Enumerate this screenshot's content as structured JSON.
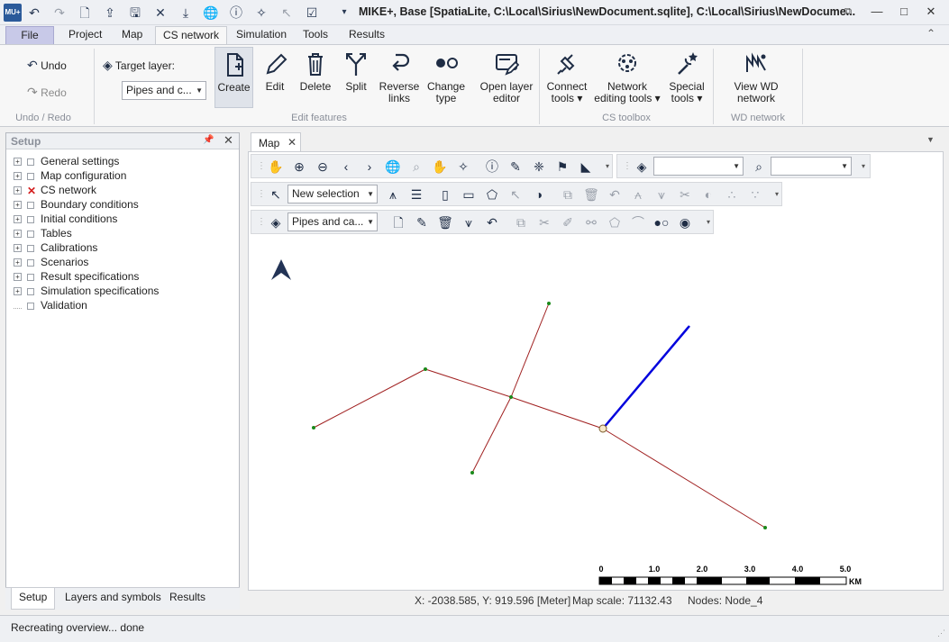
{
  "window": {
    "title": "MIKE+, Base [SpatiaLite, C:\\Local\\Sirius\\NewDocument.sqlite], C:\\Local\\Sirius\\NewDocume...",
    "minimize_icon": "restore-icon",
    "maximize_icon": "maximize-icon",
    "close_icon": "close-icon"
  },
  "quick_access": [
    "app-logo-icon",
    "undo-icon",
    "redo-icon",
    "new-document-icon",
    "open-icon",
    "save-icon",
    "close-document-icon",
    "import-icon",
    "globe-icon",
    "info-icon",
    "select-tool-icon",
    "deselect-tool-icon",
    "check-icon",
    "dropdown-icon"
  ],
  "tabs": [
    {
      "label": "File"
    },
    {
      "label": "Project"
    },
    {
      "label": "Map"
    },
    {
      "label": "CS network"
    },
    {
      "label": "Simulation"
    },
    {
      "label": "Tools"
    },
    {
      "label": "Results"
    }
  ],
  "active_tab": "CS network",
  "ribbon": {
    "undo_label": "Undo",
    "redo_label": "Redo",
    "target_layer_label": "Target layer:",
    "target_layer_value": "Pipes and c...",
    "create_label": "Create",
    "edit_label": "Edit",
    "delete_label": "Delete",
    "split_label": "Split",
    "reverse_label_1": "Reverse",
    "reverse_label_2": "links",
    "change_label_1": "Change",
    "change_label_2": "type",
    "open_layer_label_1": "Open layer",
    "open_layer_label_2": "editor",
    "connect_label_1": "Connect",
    "connect_label_2": "tools ▾",
    "network_label_1": "Network",
    "network_label_2": "editing tools ▾",
    "special_label_1": "Special",
    "special_label_2": "tools ▾",
    "wd_label_1": "View WD",
    "wd_label_2": "network",
    "groups": {
      "undo_redo": "Undo / Redo",
      "edit_features": "Edit features",
      "cs_toolbox": "CS toolbox",
      "wd_network": "WD network"
    }
  },
  "setup_panel": {
    "title": "Setup",
    "items": [
      {
        "label": "General settings"
      },
      {
        "label": "Map configuration"
      },
      {
        "label": "CS network"
      },
      {
        "label": "Boundary conditions"
      },
      {
        "label": "Initial conditions"
      },
      {
        "label": "Tables"
      },
      {
        "label": "Calibrations"
      },
      {
        "label": "Scenarios"
      },
      {
        "label": "Result specifications"
      },
      {
        "label": "Simulation specifications"
      },
      {
        "label": "Validation"
      }
    ],
    "bottom_tabs": [
      "Setup",
      "Layers and symbols",
      "Results"
    ]
  },
  "map": {
    "tab_label": "Map",
    "selection_combo": "New selection",
    "layer_combo": "Pipes and ca...",
    "search_combo": "",
    "layers_combo": "",
    "scale_ticks": [
      "0",
      "1.0",
      "2.0",
      "3.0",
      "4.0",
      "5.0"
    ],
    "scale_unit": "KM",
    "coords": "X: -2038.585, Y: 919.596 [Meter]",
    "map_scale": "Map scale: 71132.43",
    "nodes": "Nodes: Node_4",
    "colors": {
      "pipe": "#a02020",
      "selected_link": "#0000dd",
      "node": "#1a8a1a"
    }
  },
  "status": {
    "message": "Recreating overview... done"
  }
}
